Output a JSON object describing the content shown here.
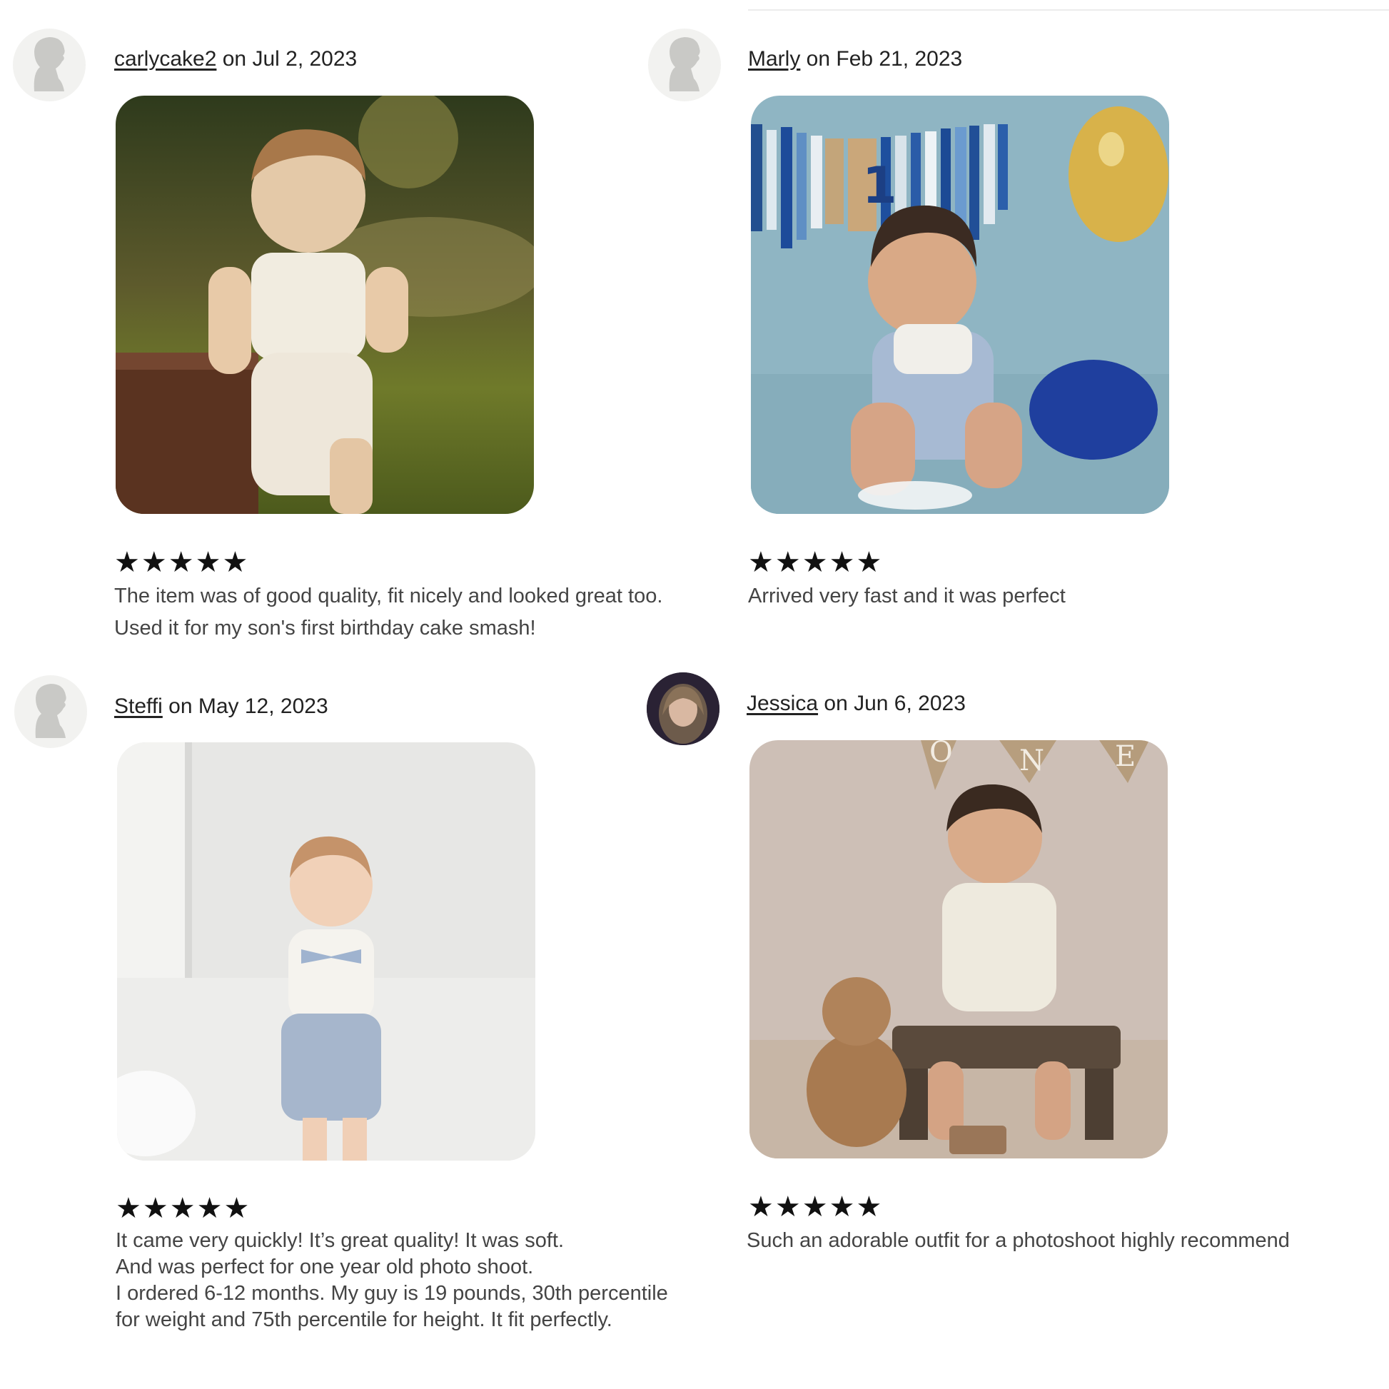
{
  "reviews": [
    {
      "user": "carlycake2",
      "date_text": " on Jul 2, 2023",
      "stars": "★★★★★",
      "rating": 5,
      "lines": [
        "The item was of good quality, fit nicely and looked great too.",
        "Used it for my son's first birthday cake smash!"
      ]
    },
    {
      "user": "Marly",
      "date_text": " on Feb 21, 2023",
      "stars": "★★★★★",
      "rating": 5,
      "lines": [
        "Arrived very fast and it was perfect"
      ]
    },
    {
      "user": "Steffi",
      "date_text": " on May 12, 2023",
      "stars": "★★★★★",
      "rating": 5,
      "lines": [
        "It came very quickly! It’s great quality! It was soft.",
        "And was perfect for one year old photo shoot.",
        "I ordered 6-12 months. My guy is 19 pounds, 30th percentile",
        "for weight and 75th percentile for height. It fit perfectly."
      ]
    },
    {
      "user": "Jessica",
      "date_text": " on Jun 6, 2023",
      "stars": "★★★★★",
      "rating": 5,
      "lines": [
        "Such an adorable outfit for a photoshoot highly recommend"
      ]
    }
  ],
  "banner_letters": [
    "O",
    "N",
    "E"
  ],
  "colors": {
    "star": "#111111",
    "text": "#444444",
    "avatar_placeholder": "#c9c9c6",
    "avatar_bg": "#f2f2f0"
  }
}
